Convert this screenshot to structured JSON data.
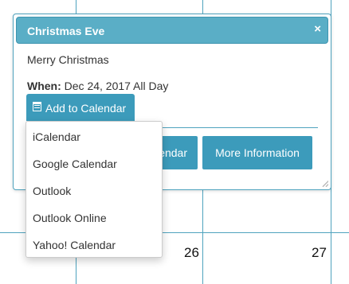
{
  "calendar": {
    "visible_days": [
      "26",
      "27"
    ]
  },
  "popup": {
    "title": "Christmas Eve",
    "close_icon": "×",
    "description": "Merry Christmas",
    "when_label": "When:",
    "when_value": "Dec 24, 2017 All Day",
    "add_to_calendar_label": "Add to Calendar",
    "calendar_button_label": "endar",
    "more_info_label": "More Information"
  },
  "dropdown": {
    "items": [
      "iCalendar",
      "Google Calendar",
      "Outlook",
      "Outlook Online",
      "Yahoo! Calendar"
    ]
  },
  "colors": {
    "header": "#5aaec6",
    "button": "#3c9bbb",
    "grid": "#4fa3be"
  }
}
